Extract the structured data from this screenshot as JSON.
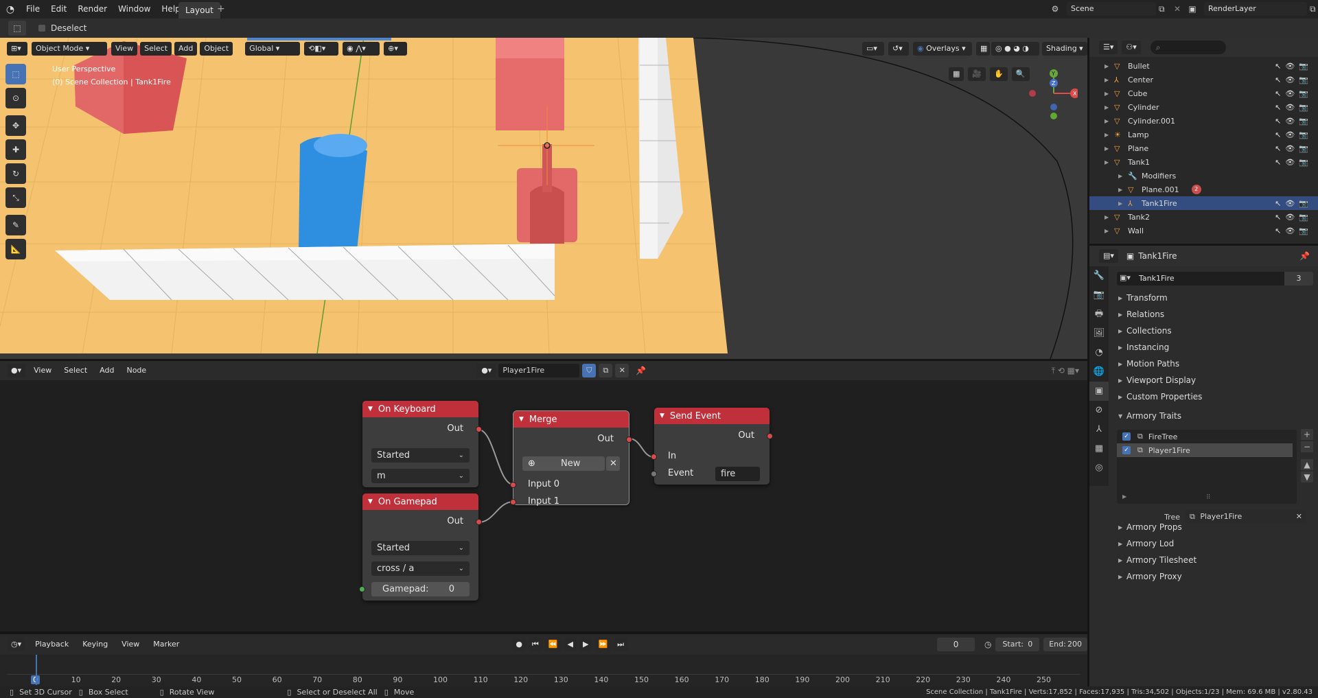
{
  "topbar": {
    "menus": [
      "File",
      "Edit",
      "Render",
      "Window",
      "Help"
    ],
    "workspace_tab": "Layout",
    "add_tab": "+",
    "scene": "Scene",
    "render_layer": "RenderLayer"
  },
  "toolsettings": {
    "deselect": "Deselect"
  },
  "viewport": {
    "mode": "Object Mode",
    "menus": [
      "View",
      "Select",
      "Add",
      "Object"
    ],
    "orientation": "Global",
    "overlays": "Overlays",
    "shading": "Shading",
    "info_line1": "User Perspective",
    "info_line2": "(0) Scene Collection | Tank1Fire",
    "gizmo": {
      "z": "Z",
      "y": "Y",
      "x": "X"
    }
  },
  "outliner": {
    "search_placeholder": "",
    "rows": [
      {
        "name": "Bullet",
        "indent": 0
      },
      {
        "name": "Center",
        "indent": 0
      },
      {
        "name": "Cube",
        "indent": 0
      },
      {
        "name": "Cylinder",
        "indent": 0
      },
      {
        "name": "Cylinder.001",
        "indent": 0
      },
      {
        "name": "Lamp",
        "indent": 0
      },
      {
        "name": "Plane",
        "indent": 0
      },
      {
        "name": "Tank1",
        "indent": 0
      },
      {
        "name": "Modifiers",
        "indent": 1
      },
      {
        "name": "Plane.001",
        "indent": 1
      },
      {
        "name": "Tank1Fire",
        "indent": 1
      },
      {
        "name": "Tank2",
        "indent": 0
      },
      {
        "name": "Wall",
        "indent": 0
      }
    ],
    "plane001_badge": "2"
  },
  "properties": {
    "header_title": "Tank1Fire",
    "object_name": "Tank1Fire",
    "user_count": "3",
    "panels_top": [
      "Transform",
      "Relations",
      "Collections",
      "Instancing",
      "Motion Paths",
      "Viewport Display",
      "Custom Properties"
    ],
    "armory_traits": "Armory Traits",
    "traits": [
      {
        "name": "FireTree",
        "checked": true
      },
      {
        "name": "Player1Fire",
        "checked": true
      }
    ],
    "tree_label": "Tree",
    "tree_value": "Player1Fire",
    "panels_bottom": [
      "Armory Props",
      "Armory Lod",
      "Armory Tilesheet",
      "Armory Proxy"
    ]
  },
  "node_editor": {
    "menus": [
      "View",
      "Select",
      "Add",
      "Node"
    ],
    "tree_name": "Player1Fire",
    "nodes": {
      "keyboard": {
        "title": "On Keyboard",
        "out": "Out",
        "state": "Started",
        "key": "m"
      },
      "gamepad": {
        "title": "On Gamepad",
        "out": "Out",
        "state": "Started",
        "button": "cross / a",
        "gamepad_label": "Gamepad:",
        "gamepad_value": "0"
      },
      "merge": {
        "title": "Merge",
        "out": "Out",
        "new": "New",
        "input0": "Input 0",
        "input1": "Input 1"
      },
      "send_event": {
        "title": "Send Event",
        "out": "Out",
        "in": "In",
        "event": "Event",
        "event_value": "fire"
      }
    }
  },
  "timeline": {
    "menus": [
      "Playback",
      "Keying",
      "View",
      "Marker"
    ],
    "current_frame": "0",
    "start_label": "Start:",
    "start": "0",
    "end_label": "End:",
    "end": "200",
    "ticks": [
      "0",
      "10",
      "20",
      "30",
      "40",
      "50",
      "60",
      "70",
      "80",
      "90",
      "100",
      "110",
      "120",
      "130",
      "140",
      "150",
      "160",
      "170",
      "180",
      "190",
      "200",
      "210",
      "220",
      "230",
      "240",
      "250"
    ]
  },
  "statusbar": {
    "items": [
      "Set 3D Cursor",
      "Box Select",
      "Rotate View",
      "Select or Deselect All",
      "Move"
    ],
    "stats": "Scene Collection | Tank1Fire | Verts:17,852 | Faces:17,935 | Tris:34,502 | Objects:1/23 | Mem: 69.6 MB | v2.80.43"
  },
  "colors": {
    "node_header": "#c0303b",
    "selection": "#4772b3",
    "socket": "#d94b4b"
  }
}
